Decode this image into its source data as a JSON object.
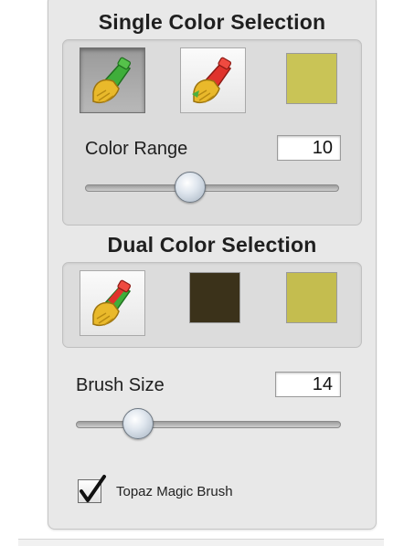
{
  "single_color": {
    "title": "Single Color Selection",
    "swatch_color": "#c9c456",
    "color_range_label": "Color Range",
    "color_range_value": "10",
    "color_range_fraction": 0.4
  },
  "dual_color": {
    "title": "Dual Color Selection",
    "swatch_1_color": "#3b321a",
    "swatch_2_color": "#c4bd4f"
  },
  "brush": {
    "size_label": "Brush Size",
    "size_value": "14",
    "size_fraction": 0.2
  },
  "magic_brush": {
    "label": "Topaz Magic Brush",
    "checked": true
  },
  "icons": {
    "brush_green": "brush-green-icon",
    "brush_red": "brush-red-icon",
    "brush_dual": "brush-dual-icon",
    "checkmark": "checkmark-icon"
  }
}
